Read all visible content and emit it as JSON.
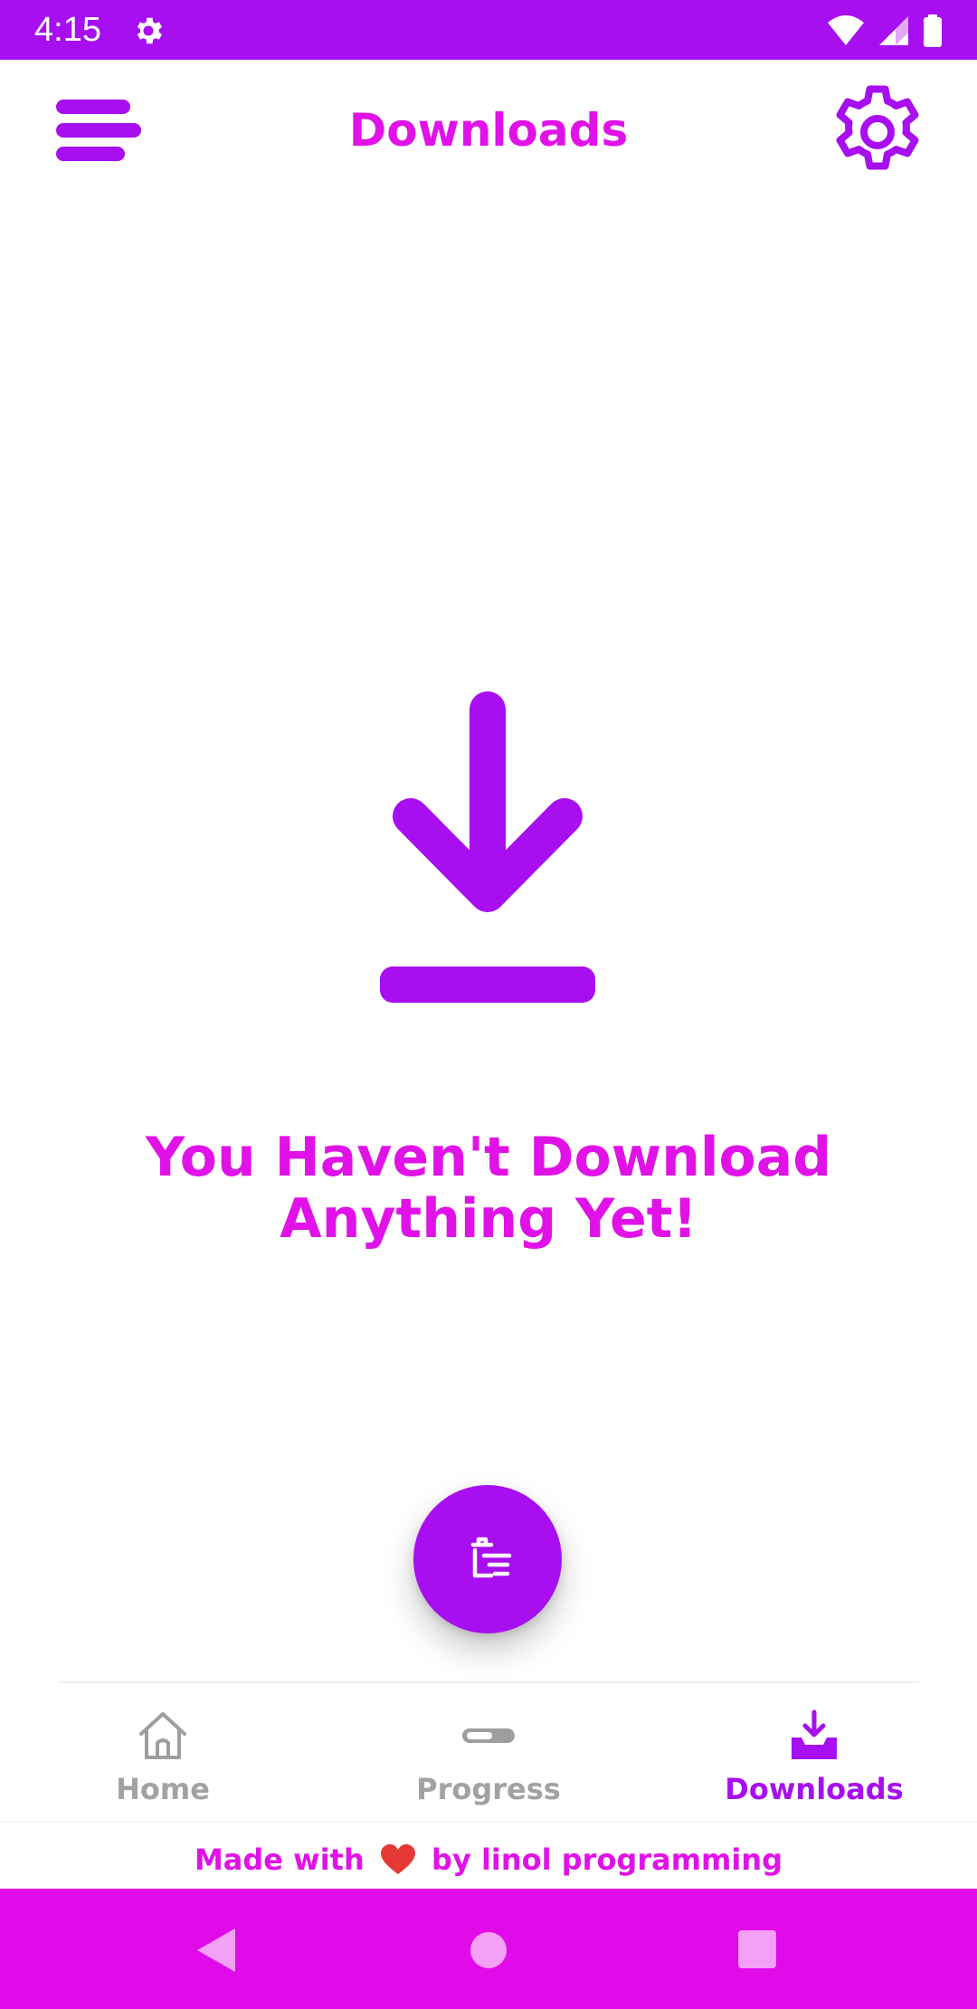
{
  "status_bar": {
    "time": "4:15",
    "icons": [
      "settings-icon",
      "wifi-icon",
      "signal-icon",
      "battery-icon"
    ],
    "background": "#a70ef0"
  },
  "header": {
    "title": "Downloads",
    "menu_icon": "menu-icon",
    "settings_icon": "gear-icon"
  },
  "empty_state": {
    "icon": "download-icon",
    "line1": "You Haven't Download",
    "line2": "Anything Yet!"
  },
  "fab": {
    "icon": "clear-list-icon"
  },
  "bottom_nav": {
    "items": [
      {
        "label": "Home",
        "icon": "home-icon",
        "active": false
      },
      {
        "label": "Progress",
        "icon": "progress-icon",
        "active": false
      },
      {
        "label": "Downloads",
        "icon": "download-tray-icon",
        "active": true
      }
    ]
  },
  "footer": {
    "prefix": "Made with",
    "suffix": "by linol programming",
    "icon": "heart-icon"
  },
  "system_nav": {
    "buttons": [
      "back-icon",
      "home-circle-icon",
      "recents-icon"
    ]
  },
  "colors": {
    "accent": "#a70ef0",
    "title_magenta": "#e012e8",
    "system_nav": "#e10ae9",
    "inactive": "#a2a2a2",
    "heart": "#e53935"
  }
}
